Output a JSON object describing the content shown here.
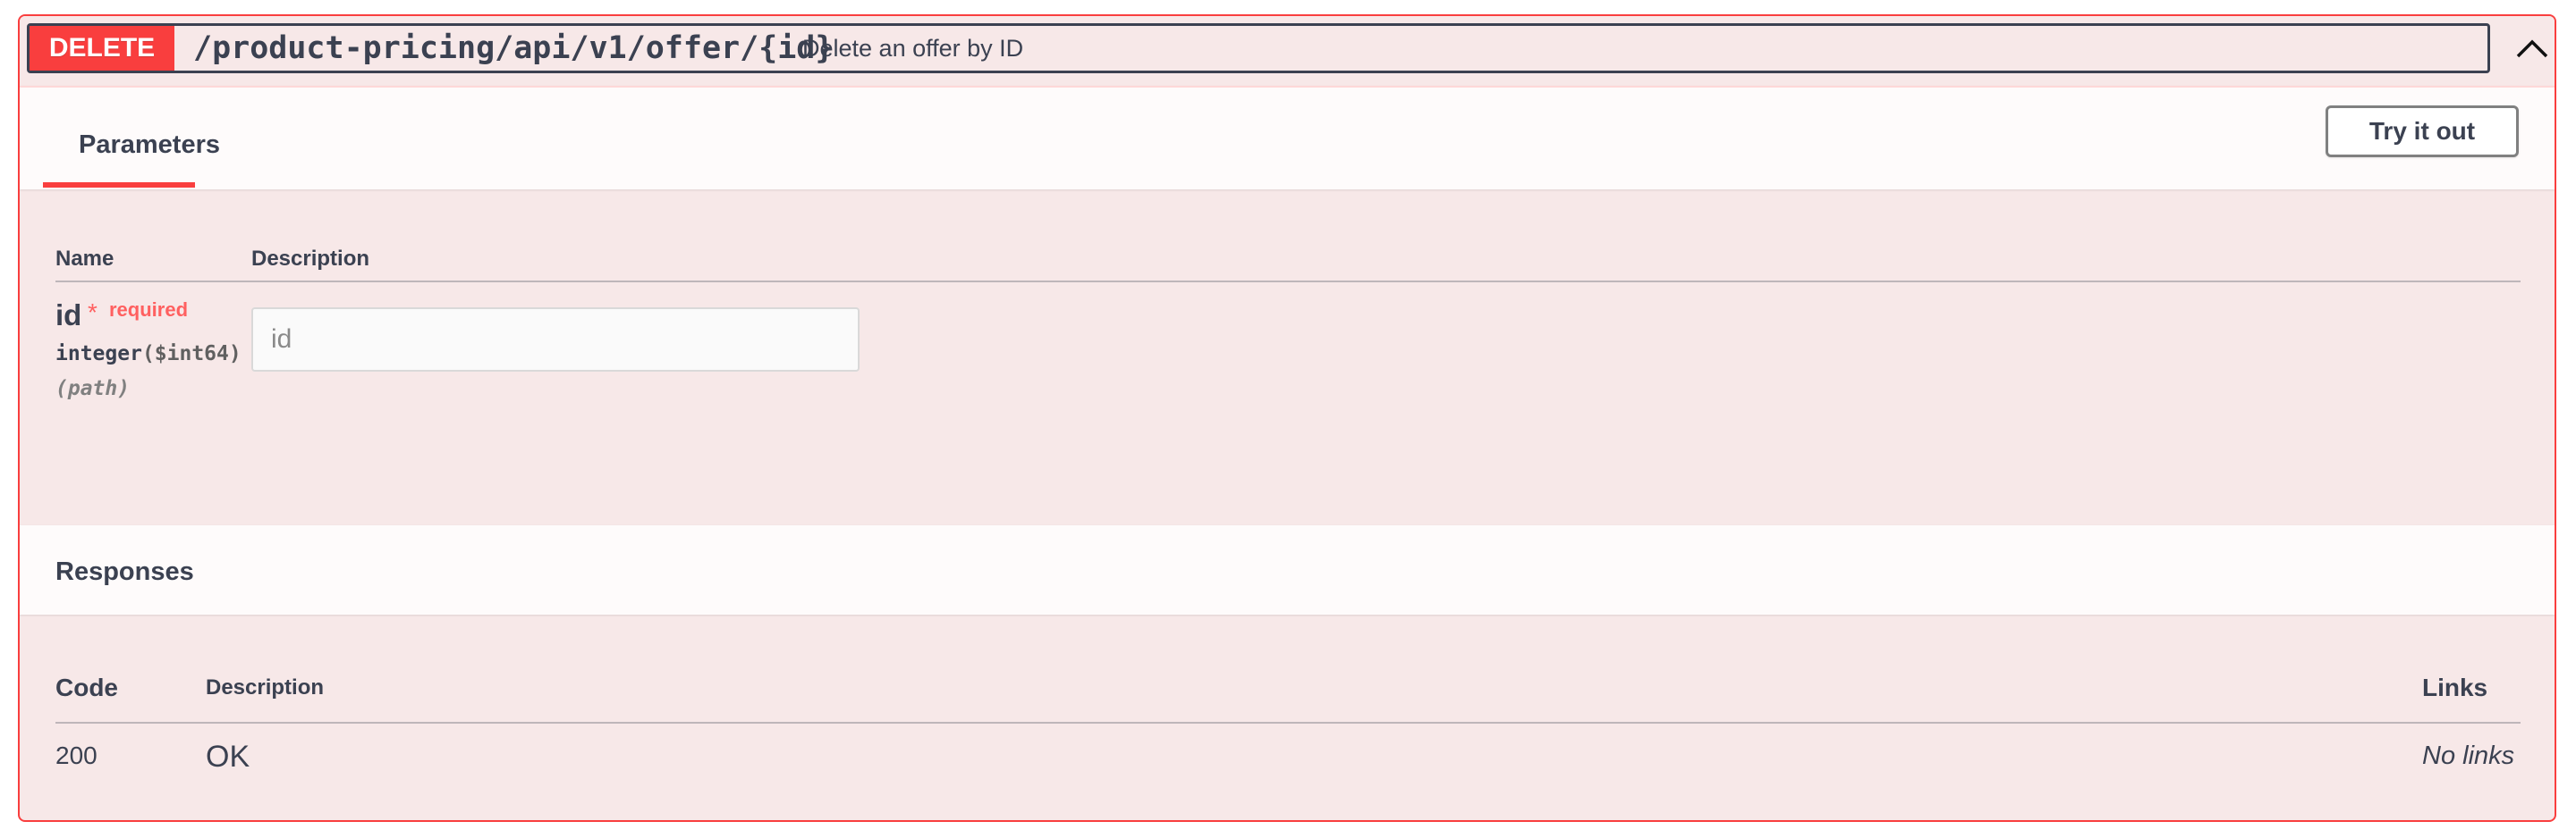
{
  "operation": {
    "method": "DELETE",
    "path": "/product-pricing/api/v1/offer/{id}",
    "summary": "Delete an offer by ID",
    "collapse_icon": "chevron-up-icon",
    "accent_color": "#f93e3e"
  },
  "parameters": {
    "tab_label": "Parameters",
    "try_button_label": "Try it out",
    "columns": [
      "Name",
      "Description"
    ],
    "items": [
      {
        "name": "id",
        "required_mark": "*",
        "required_label": "required",
        "type": "integer",
        "format": "($int64)",
        "in": "(path)",
        "placeholder": "id",
        "value": ""
      }
    ]
  },
  "responses": {
    "title": "Responses",
    "columns": [
      "Code",
      "Description",
      "Links"
    ],
    "rows": [
      {
        "code": "200",
        "description": "OK",
        "links": "No links"
      }
    ]
  }
}
